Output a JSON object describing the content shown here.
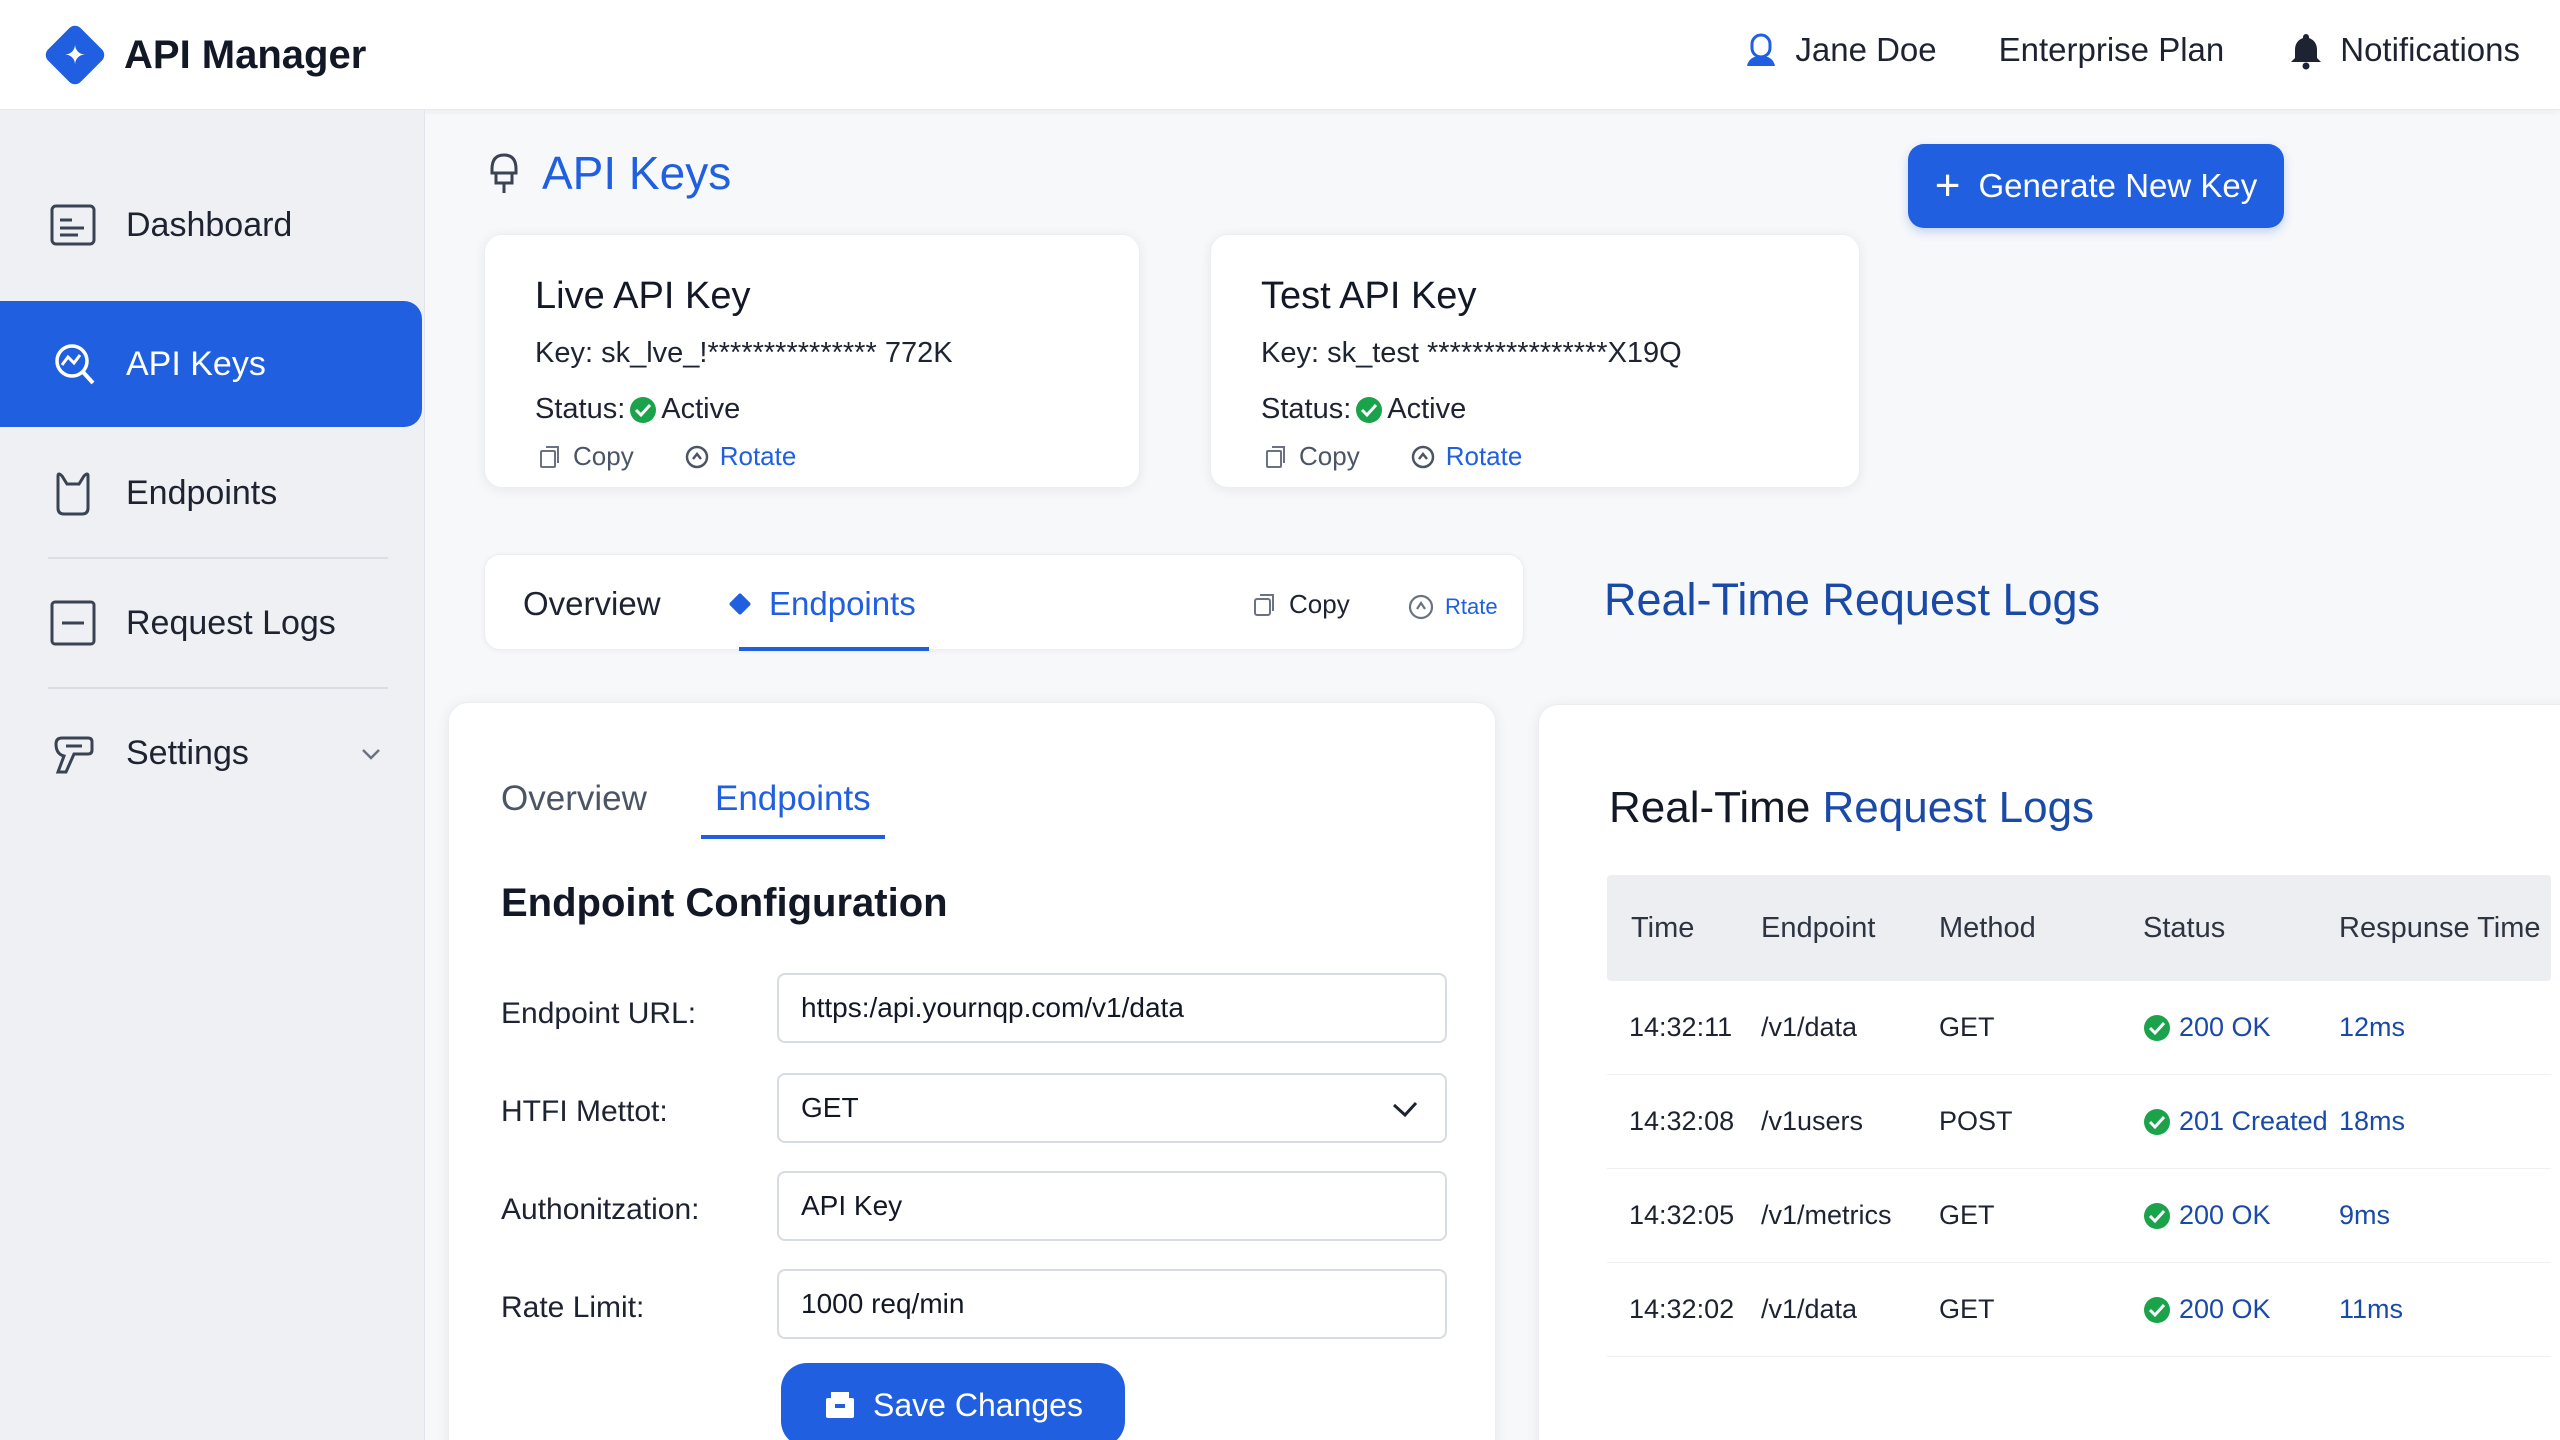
{
  "app": {
    "title": "API Manager"
  },
  "header": {
    "user_name": "Jane Doe",
    "plan": "Enterprise Plan",
    "notifications_label": "Notifications"
  },
  "sidebar": {
    "items": [
      {
        "label": "Dashboard",
        "icon": "dashboard-icon",
        "active": false
      },
      {
        "label": "API Keys",
        "icon": "api-keys-icon",
        "active": true
      },
      {
        "label": "Endpoints",
        "icon": "endpoints-icon",
        "active": false
      },
      {
        "label": "Request Logs",
        "icon": "request-logs-icon",
        "active": false
      },
      {
        "label": "Settings",
        "icon": "settings-icon",
        "active": false
      }
    ]
  },
  "page": {
    "title": "API Keys",
    "generate_button": "Generate New Key"
  },
  "keys": [
    {
      "title": "Live API Key",
      "key": "Key: sk_lve_!*************** 772K",
      "status_label": "Status:",
      "status_value": "Active",
      "copy": "Copy",
      "rotate": "Rotate"
    },
    {
      "title": "Test API Key",
      "key": "Key: sk_test ****************X19Q",
      "status_label": "Status:",
      "status_value": "Active",
      "copy": "Copy",
      "rotate": "Rotate"
    }
  ],
  "tabbar": {
    "tabs": [
      "Overview",
      "Endpoints"
    ],
    "copy": "Copy",
    "rotate": "Rtate",
    "section_title": "Real-Time Request Logs"
  },
  "config": {
    "tabs": [
      "Overview",
      "Endpoints"
    ],
    "title": "Endpoint Configuration",
    "fields": [
      {
        "label": "Endpoint URL:",
        "value": "https:/api.yournqp.com/v1/data"
      },
      {
        "label": "HTFI Mettot:",
        "value": "GET"
      },
      {
        "label": "Authonitzation:",
        "value": "API Key"
      },
      {
        "label": "Rate Limit:",
        "value": "1000 req/min"
      }
    ],
    "save_button": "Save Changes"
  },
  "logs": {
    "title_part1": "Real-Time",
    "title_part2": "Request Logs",
    "columns": [
      "Time",
      "Endpoint",
      "Method",
      "Status",
      "Respunse Time"
    ],
    "rows": [
      {
        "time": "14:32:11",
        "endpoint": "/v1/data",
        "method": "GET",
        "status": "200 OK",
        "response": "12ms"
      },
      {
        "time": "14:32:08",
        "endpoint": "/v1users",
        "method": "POST",
        "status": "201 Created",
        "response": "18ms"
      },
      {
        "time": "14:32:05",
        "endpoint": "/v1/metrics",
        "method": "GET",
        "status": "200 OK",
        "response": "9ms"
      },
      {
        "time": "14:32:02",
        "endpoint": "/v1/data",
        "method": "GET",
        "status": "200 OK",
        "response": "11ms"
      }
    ]
  },
  "colors": {
    "accent": "#1f5fe0",
    "success": "#1aa34a",
    "link": "#1a4aa8"
  }
}
